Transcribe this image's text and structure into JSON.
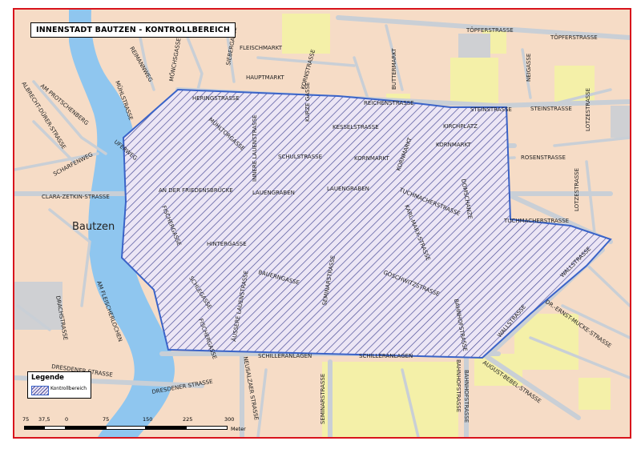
{
  "map": {
    "title": "INNENSTADT BAUTZEN - KONTROLLBEREICH",
    "town_label": "Bautzen",
    "legend": {
      "title": "Legende",
      "item_label": "Kontrollbereich"
    },
    "scale": {
      "ticks": [
        "75",
        "37,5",
        "0",
        "75",
        "150",
        "225",
        "300"
      ],
      "unit": "Meter"
    },
    "colors": {
      "background": "#f6dcc6",
      "road": "#c9cfd6",
      "water": "#8fc6ef",
      "green": "#f4f0a8",
      "control_area": "#3a63c8",
      "frame": "#d8141c"
    },
    "streets": [
      "TÖPFERSTRASSE",
      "TÖPFERSTRASSE",
      "NEIGASSE",
      "FLEISCHMARKT",
      "SIEBERGASSE",
      "MÖNCHSGASSE",
      "REICHENSTRASSE",
      "HAUPTMARKT",
      "KORNSTRASSE",
      "BUTTERMARKT",
      "REIMANNWEG",
      "MÜHLSTRASSE",
      "AM PROTSCHENBERG",
      "HERINGSTRASSE",
      "ALBRECHT-DÜRER-STRASSE",
      "KURZE GASSE",
      "STEINSTRASSE",
      "STEINSTRASSE",
      "INNERE LAUENSTRASSE",
      "MÜHLTORGASSE",
      "KESSELSTRASSE",
      "KIRCHPLATZ",
      "LOTZESTRASSE",
      "SCHARFENWEG",
      "UFERWEG",
      "SCHULSTRASSE",
      "KORNMARKT",
      "KORNMARKT",
      "KORNMARKT",
      "ROSENSTRASSE",
      "DOMSCHANZE",
      "LOTZESTRASSE",
      "CLARA-ZETKIN-STRASSE",
      "AN DER FRIEDENSBRÜCKE",
      "LAUENGRABEN",
      "LAUENGRABEN",
      "TUCHMACHERSTRASSE",
      "TUCHMACHERSTRASSE",
      "FISCHERGASSE",
      "KARL-MARX-STRASSE",
      "HINTERGASSE",
      "SEMINARSTRASSE",
      "WALLSTRASSE",
      "BAUERNGASSE",
      "AM FLEISCHERLOCHEN",
      "GOSCHWITZSTRASSE",
      "ÄUSSERE LAUENSTRASSE",
      "SCHLEGASSE",
      "DRACHSTRASSE",
      "WALLSTRASSE",
      "DR.-ERNST-MUCKE-STRASSE",
      "BAHNHOFSTRASSE",
      "FISCHERGASSE",
      "SCHILLERANLAGEN",
      "SCHILLERANLAGEN",
      "DRESDENER STRASSE",
      "AUGUST-BEBEL-STRASSE",
      "BAHNHOFSTRASSE",
      "NEUSALZAER STRASSE",
      "SEMINARSTRASSE",
      "DRESDENER STRASSE",
      "BAHNHOFSTRASSE"
    ]
  }
}
